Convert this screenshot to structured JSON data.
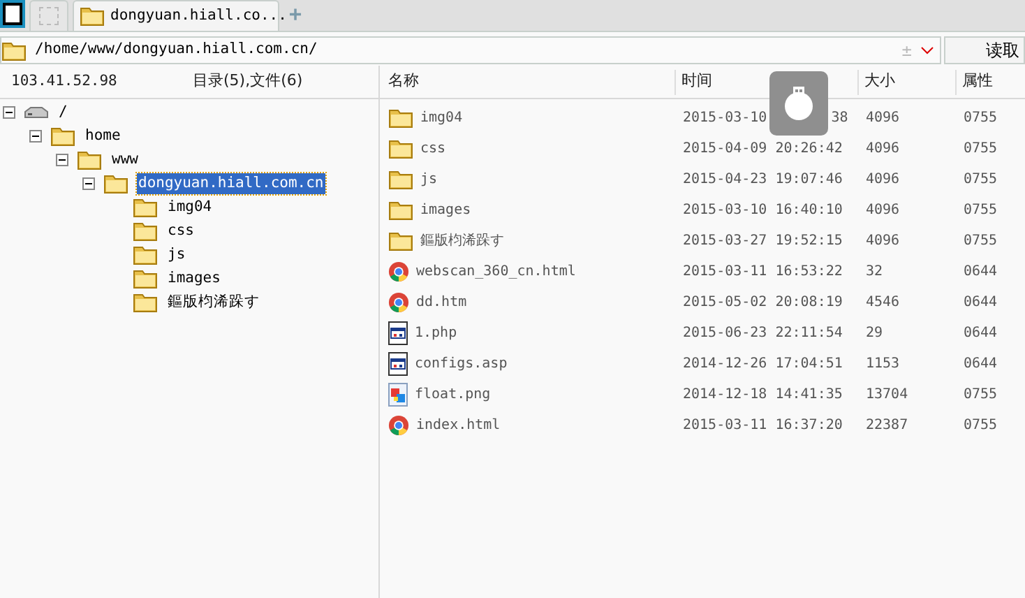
{
  "tabs": [
    {
      "kind": "icon",
      "selected": false
    },
    {
      "kind": "folder",
      "label": "dongyuan.hiall.co...",
      "selected": true
    }
  ],
  "new_tab": "+",
  "address": {
    "value": "/home/www/dongyuan.hiall.com.cn/",
    "plus": "±",
    "read_button": "读取"
  },
  "info": {
    "host": "103.41.52.98",
    "summary": "目录(5),文件(6)"
  },
  "columns": [
    "名称",
    "时间",
    "大小",
    "属性"
  ],
  "tree": [
    {
      "label": "/",
      "kind": "drive",
      "expanded": true,
      "selected": false,
      "children": [
        {
          "label": "home",
          "kind": "folder",
          "expanded": true,
          "selected": false,
          "children": [
            {
              "label": "www",
              "kind": "folder",
              "expanded": true,
              "selected": false,
              "children": [
                {
                  "label": "dongyuan.hiall.com.cn",
                  "kind": "folder",
                  "expanded": true,
                  "selected": true,
                  "children": [
                    {
                      "label": "img04",
                      "kind": "folder",
                      "selected": false
                    },
                    {
                      "label": "css",
                      "kind": "folder",
                      "selected": false
                    },
                    {
                      "label": "js",
                      "kind": "folder",
                      "selected": false
                    },
                    {
                      "label": "images",
                      "kind": "folder",
                      "selected": false
                    },
                    {
                      "label": "鏂版枃浠跺す",
                      "kind": "folder",
                      "selected": false
                    }
                  ]
                }
              ]
            }
          ]
        }
      ]
    }
  ],
  "files": [
    {
      "kind": "folder",
      "name": "img04",
      "time": "2015-03-10",
      "time_tail": "38",
      "size": "4096",
      "attr": "0755"
    },
    {
      "kind": "folder",
      "name": "css",
      "time": "2015-04-09 20:26:42",
      "size": "4096",
      "attr": "0755"
    },
    {
      "kind": "folder",
      "name": "js",
      "time": "2015-04-23 19:07:46",
      "size": "4096",
      "attr": "0755"
    },
    {
      "kind": "folder",
      "name": "images",
      "time": "2015-03-10 16:40:10",
      "size": "4096",
      "attr": "0755"
    },
    {
      "kind": "folder",
      "name": "鏂版枃浠跺す",
      "time": "2015-03-27 19:52:15",
      "size": "4096",
      "attr": "0755"
    },
    {
      "kind": "web",
      "name": "webscan_360_cn.html",
      "time": "2015-03-11 16:53:22",
      "size": "32",
      "attr": "0644"
    },
    {
      "kind": "web",
      "name": "dd.htm",
      "time": "2015-05-02 20:08:19",
      "size": "4546",
      "attr": "0644"
    },
    {
      "kind": "script",
      "name": "1.php",
      "time": "2015-06-23 22:11:54",
      "size": "29",
      "attr": "0644"
    },
    {
      "kind": "script",
      "name": "configs.asp",
      "time": "2014-12-26 17:04:51",
      "size": "1153",
      "attr": "0644"
    },
    {
      "kind": "image",
      "name": "float.png",
      "time": "2014-12-18 14:41:35",
      "size": "13704",
      "attr": "0755"
    },
    {
      "kind": "web",
      "name": "index.html",
      "time": "2015-03-11 16:37:20",
      "size": "22387",
      "attr": "0755"
    }
  ]
}
